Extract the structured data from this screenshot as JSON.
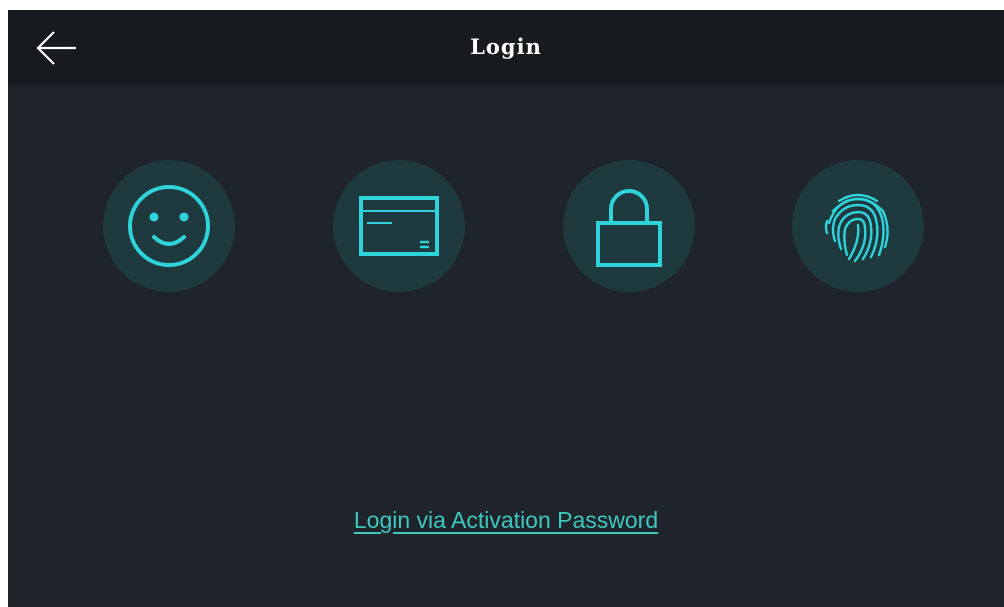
{
  "header": {
    "title": "Login",
    "back_icon": "arrow-left-icon"
  },
  "login_methods": [
    {
      "name": "face",
      "icon": "smiley-face-icon"
    },
    {
      "name": "card",
      "icon": "credit-card-icon"
    },
    {
      "name": "password",
      "icon": "padlock-icon"
    },
    {
      "name": "fingerprint",
      "icon": "fingerprint-icon"
    }
  ],
  "activation_link": {
    "label": "Login via Activation Password"
  },
  "colors": {
    "background": "#1f242a",
    "header_background": "#171a1e",
    "icon_circle": "#1f3a3e",
    "accent": "#2ed3db",
    "link": "#3ec7c0",
    "title_text": "#ffffff"
  }
}
